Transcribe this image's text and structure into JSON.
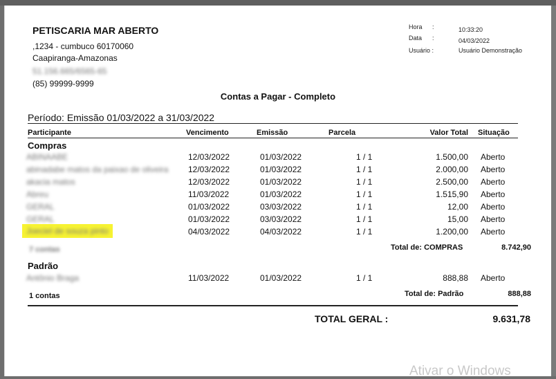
{
  "company": {
    "name": "PETISCARIA MAR ABERTO",
    "address": ",1234 - cumbuco  60170060",
    "city": "Caapiranga-Amazonas",
    "document_blurred": "51.156.665/6565-65",
    "phone": "(85) 99999-9999"
  },
  "meta": {
    "hora_label": "Hora",
    "hora_value": "10:33:20",
    "data_label": "Data",
    "data_value": "04/03/2022",
    "usuario_label": "Usuário :",
    "usuario_value": "Usuário Demonstração",
    "colon": ":"
  },
  "report": {
    "title": "Contas a Pagar - Completo",
    "period": "Período: Emissão 01/03/2022 a 31/03/2022"
  },
  "columns": {
    "participante": "Participante",
    "vencimento": "Vencimento",
    "emissao": "Emissão",
    "parcela": "Parcela",
    "valor_total": "Valor Total",
    "situacao": "Situação"
  },
  "groups": [
    {
      "name": "Compras",
      "rows": [
        {
          "participante": "ABINAABE",
          "vencimento": "12/03/2022",
          "emissao": "01/03/2022",
          "parcela": "1 / 1",
          "valor": "1.500,00",
          "situacao": "Aberto"
        },
        {
          "participante": "abinadabe matos da paixao de oliveira",
          "vencimento": "12/03/2022",
          "emissao": "01/03/2022",
          "parcela": "1 / 1",
          "valor": "2.000,00",
          "situacao": "Aberto"
        },
        {
          "participante": "akacia matos",
          "vencimento": "12/03/2022",
          "emissao": "01/03/2022",
          "parcela": "1 / 1",
          "valor": "2.500,00",
          "situacao": "Aberto"
        },
        {
          "participante": "Abreu",
          "vencimento": "11/03/2022",
          "emissao": "01/03/2022",
          "parcela": "1 / 1",
          "valor": "1.515,90",
          "situacao": "Aberto"
        },
        {
          "participante": "GERAL",
          "vencimento": "01/03/2022",
          "emissao": "03/03/2022",
          "parcela": "1 / 1",
          "valor": "12,00",
          "situacao": "Aberto"
        },
        {
          "participante": "GERAL",
          "vencimento": "01/03/2022",
          "emissao": "03/03/2022",
          "parcela": "1 / 1",
          "valor": "15,00",
          "situacao": "Aberto"
        },
        {
          "participante": "Joeciel de souza pinto",
          "vencimento": "04/03/2022",
          "emissao": "04/03/2022",
          "parcela": "1 / 1",
          "valor": "1.200,00",
          "situacao": "Aberto"
        }
      ],
      "count": "7 contas",
      "total_label": "Total de: COMPRAS",
      "total_value": "8.742,90"
    },
    {
      "name": "Padrão",
      "rows": [
        {
          "participante": "Antônio Braga",
          "vencimento": "11/03/2022",
          "emissao": "01/03/2022",
          "parcela": "1 / 1",
          "valor": "888,88",
          "situacao": "Aberto"
        }
      ],
      "count": "1 contas",
      "total_label": "Total de: Padrão",
      "total_value": "888,88"
    }
  ],
  "grand_total": {
    "label": "TOTAL GERAL :",
    "value": "9.631,78"
  },
  "watermark": "Ativar o Windows",
  "colors": {
    "highlight": "#f7f332",
    "paper": "#ffffff",
    "frame": "#6e6e6e"
  }
}
